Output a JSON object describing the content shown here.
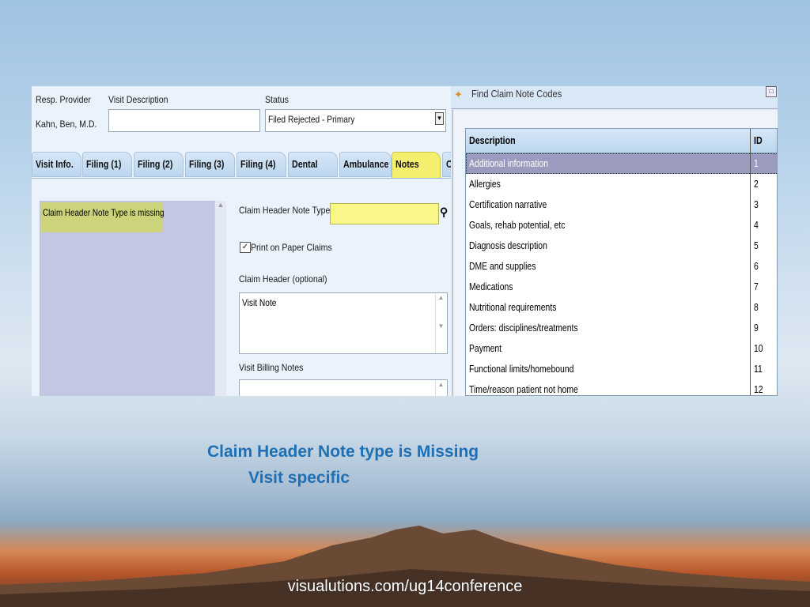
{
  "visit_form": {
    "resp_provider_label": "Resp. Provider",
    "resp_provider_value": "Kahn, Ben, M.D.",
    "visit_description_label": "Visit Description",
    "visit_description_value": "",
    "status_label": "Status",
    "status_value": "Filed Rejected - Primary",
    "tabs": [
      "Visit Info.",
      "Filing (1)",
      "Filing (2)",
      "Filing (3)",
      "Filing (4)",
      "Dental",
      "Ambulance",
      "Notes",
      "C"
    ],
    "active_tab": "Notes",
    "validation_message": "Claim Header Note Type is missing",
    "claim_header_note_type_label": "Claim Header Note Type",
    "claim_header_note_type_value": "",
    "print_on_paper_label": "Print on Paper Claims",
    "print_on_paper_checked": true,
    "claim_header_label": "Claim Header (optional)",
    "claim_header_value": "Visit Note",
    "visit_billing_notes_label": "Visit Billing Notes",
    "visit_billing_notes_value": ""
  },
  "dialog": {
    "title": "Find Claim Note Codes",
    "columns": [
      "Description",
      "ID"
    ],
    "rows": [
      {
        "description": "Additional information",
        "id": "1",
        "selected": true
      },
      {
        "description": "Allergies",
        "id": "2"
      },
      {
        "description": "Certification narrative",
        "id": "3"
      },
      {
        "description": "Goals, rehab potential, etc",
        "id": "4"
      },
      {
        "description": "Diagnosis description",
        "id": "5"
      },
      {
        "description": "DME and supplies",
        "id": "6"
      },
      {
        "description": "Medications",
        "id": "7"
      },
      {
        "description": "Nutritional requirements",
        "id": "8"
      },
      {
        "description": "Orders: disciplines/treatments",
        "id": "9"
      },
      {
        "description": "Payment",
        "id": "10"
      },
      {
        "description": "Functional limits/homebound",
        "id": "11"
      },
      {
        "description": "Time/reason patient not home",
        "id": "12"
      }
    ]
  },
  "slide": {
    "caption_line1": "Claim Header Note type is Missing",
    "caption_line2": "Visit specific",
    "footer": "visualutions.com/ug14conference"
  },
  "colors": {
    "caption_blue": "#1f6fb5",
    "active_tab": "#f4f06e",
    "selected_row": "#9b9bbf",
    "required_field": "#f9f68a"
  },
  "icons": [
    "binoculars-icon",
    "checkbox-checked-icon",
    "scroll-arrow-icon",
    "dropdown-arrow-icon",
    "app-icon",
    "maximize-icon"
  ]
}
